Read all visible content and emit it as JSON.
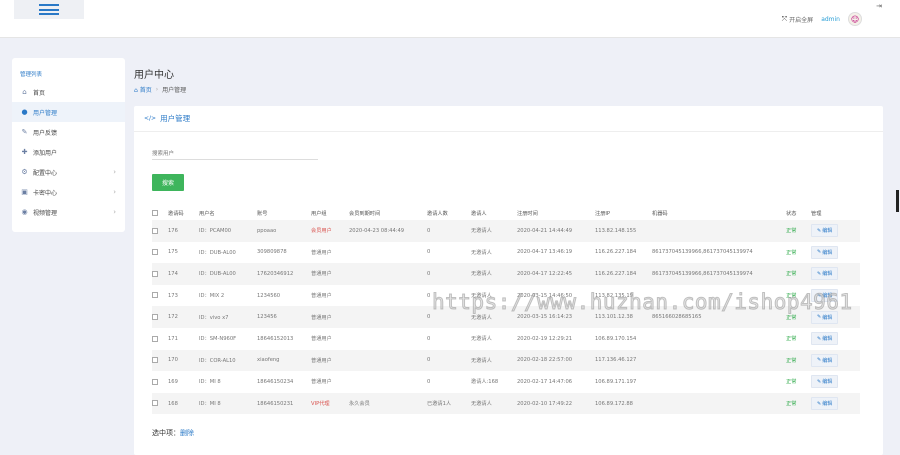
{
  "topbar": {
    "fullscreen_label": "开启全屏",
    "admin_name": "admin"
  },
  "sidebar": {
    "title": "管理列表",
    "items": [
      {
        "label": "首页",
        "icon": "home-icon"
      },
      {
        "label": "用户管理",
        "icon": "user-icon"
      },
      {
        "label": "用户反馈",
        "icon": "edit-icon"
      },
      {
        "label": "添加用户",
        "icon": "add-user-icon"
      },
      {
        "label": "配置中心",
        "icon": "gear-icon"
      },
      {
        "label": "卡密中心",
        "icon": "card-icon"
      },
      {
        "label": "视频管理",
        "icon": "video-icon"
      }
    ]
  },
  "page": {
    "title": "用户中心",
    "breadcrumb_home": "首页",
    "breadcrumb_current": "用户管理"
  },
  "card": {
    "title": "用户管理",
    "search_placeholder": "搜索用户",
    "search_button": "搜索"
  },
  "table": {
    "headers": [
      "邀请码",
      "用户名",
      "账号",
      "用户组",
      "会员到期时间",
      "邀请人数",
      "邀请人",
      "注册时间",
      "注册IP",
      "机器码",
      "状态",
      "管理"
    ],
    "edit_label": "编辑",
    "rows": [
      {
        "code": "176",
        "name": "ID：PCAM00",
        "account": "ppoaao",
        "group": "会员用户",
        "group_type": "vip",
        "expire": "2020-04-23 08:44:49",
        "invites": "0",
        "inviter": "无邀请人",
        "reg_time": "2020-04-21 14:44:49",
        "ip": "113.82.148.155",
        "machine": "",
        "status": "正常"
      },
      {
        "code": "175",
        "name": "ID：DUB-AL00",
        "account": "309809878",
        "group": "普通用户",
        "group_type": "normal",
        "expire": "",
        "invites": "0",
        "inviter": "无邀请人",
        "reg_time": "2020-04-17 13:46:19",
        "ip": "116.26.227.184",
        "machine": "861737045139966,861737045139974",
        "status": "正常"
      },
      {
        "code": "174",
        "name": "ID：DUB-AL00",
        "account": "17620346912",
        "group": "普通用户",
        "group_type": "normal",
        "expire": "",
        "invites": "0",
        "inviter": "无邀请人",
        "reg_time": "2020-04-17 12:22:45",
        "ip": "116.26.227.184",
        "machine": "861737045139966,861737045139974",
        "status": "正常"
      },
      {
        "code": "173",
        "name": "ID：MIX 2",
        "account": "1234560",
        "group": "普通用户",
        "group_type": "normal",
        "expire": "",
        "invites": "0",
        "inviter": "无邀请人",
        "reg_time": "2020-03-15 14:46:50",
        "ip": "113.82.135.19",
        "machine": "",
        "status": "正常"
      },
      {
        "code": "172",
        "name": "ID：vivo x7",
        "account": "123456",
        "group": "普通用户",
        "group_type": "normal",
        "expire": "",
        "invites": "0",
        "inviter": "无邀请人",
        "reg_time": "2020-03-15 16:14:23",
        "ip": "113.101.12.38",
        "machine": "865166028685165",
        "status": "正常"
      },
      {
        "code": "171",
        "name": "ID：SM-N960F",
        "account": "18646152013",
        "group": "普通用户",
        "group_type": "normal",
        "expire": "",
        "invites": "0",
        "inviter": "无邀请人",
        "reg_time": "2020-02-19 12:29:21",
        "ip": "106.89.170.154",
        "machine": "",
        "status": "正常"
      },
      {
        "code": "170",
        "name": "ID：COR-AL10",
        "account": "xiaofeng",
        "group": "普通用户",
        "group_type": "normal",
        "expire": "",
        "invites": "0",
        "inviter": "无邀请人",
        "reg_time": "2020-02-18 22:57:00",
        "ip": "117.136.46.127",
        "machine": "",
        "status": "正常"
      },
      {
        "code": "169",
        "name": "ID：MI 8",
        "account": "18646150234",
        "group": "普通用户",
        "group_type": "normal",
        "expire": "",
        "invites": "0",
        "inviter": "邀请人:168",
        "reg_time": "2020-02-17 14:47:06",
        "ip": "106.89.171.197",
        "machine": "",
        "status": "正常"
      },
      {
        "code": "168",
        "name": "ID：MI 8",
        "account": "18646150231",
        "group": "VIP代理",
        "group_type": "vip",
        "expire": "永久会员",
        "invites": "已邀请1人",
        "inviter": "无邀请人",
        "reg_time": "2020-02-10 17:49:22",
        "ip": "106.89.172.88",
        "machine": "",
        "status": "正常"
      }
    ]
  },
  "footer": {
    "selected_label": "选中项：",
    "delete_label": "删除"
  },
  "watermark": "https://www.huzhan.com/ishop4961",
  "colors": {
    "accent": "#2a79c7",
    "success": "#27a844",
    "danger": "#d9534f",
    "search_button": "#3eb55c"
  }
}
